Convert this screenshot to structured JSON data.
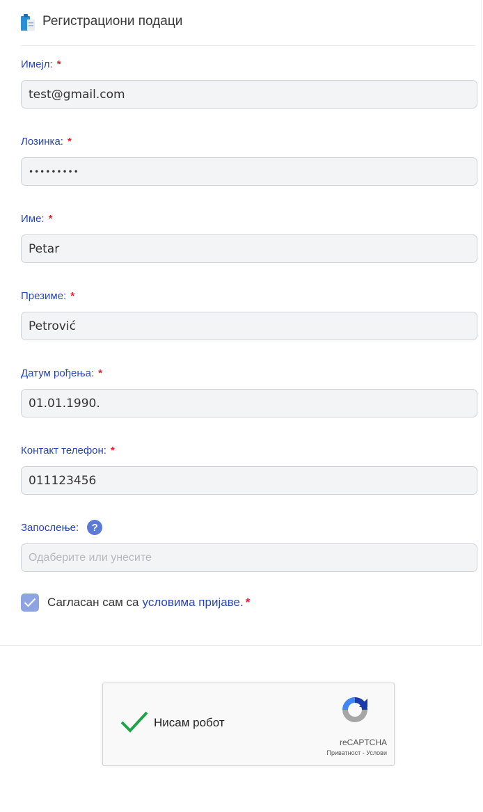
{
  "header": {
    "title": "Регистрациони подаци",
    "icon": "clipboard-icon"
  },
  "fields": {
    "email": {
      "label": "Имејл:",
      "value": "test@gmail.com"
    },
    "password": {
      "label": "Лозинка:",
      "value": "•••••••••"
    },
    "first_name": {
      "label": "Име:",
      "value": "Petar"
    },
    "last_name": {
      "label": "Презиме:",
      "value": "Petrović"
    },
    "birth_date": {
      "label": "Датум рођења:",
      "value": "01.01.1990."
    },
    "phone": {
      "label": "Контакт телефон:",
      "value": "011123456"
    },
    "employment": {
      "label": "Запослење:",
      "placeholder": "Одаберите или унесите",
      "help": "?"
    }
  },
  "required_mark": "*",
  "agree": {
    "text": "Сагласан сам са",
    "link": "условима пријаве.",
    "checked": true
  },
  "captcha": {
    "label": "Нисам робот",
    "brand": "reCAPTCHA",
    "links": "Приватност - Услови"
  },
  "colors": {
    "label": "#2846b4",
    "required": "#e0212f",
    "checkbox": "#8ea3e2",
    "check_green": "#1fa34a"
  }
}
